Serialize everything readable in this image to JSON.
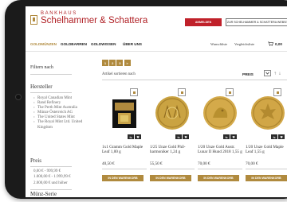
{
  "brand": {
    "top": "BANKHAUS",
    "name": "Schelhammer & Schattera"
  },
  "header": {
    "signup_label": "ANMELDEN",
    "compare_label": "ZUR SCHELHAMMER & SCHATTERA WEBSITE"
  },
  "nav": {
    "items": [
      "GOLDMÜNZEN",
      "GOLDBARREN",
      "GOLDWISSEN",
      "ÜBER UNS"
    ],
    "wishlist": "Wunschliste",
    "compare_list": "Vergleichsliste",
    "cart_total": "0,00"
  },
  "sidebar": {
    "filter_label": "Filtern nach",
    "manufacturer_heading": "Hersteller",
    "manufacturers": [
      "Royal Canadian Mint",
      "Rand Refinery",
      "The Perth Mint Australia",
      "Münze Österreich AG",
      "The United States Mint",
      "The Royal Mint Ltd. United Kingdom"
    ],
    "price_heading": "Preis",
    "prices": [
      "0,00 € - 999,99 €",
      "1.000,00 € - 1.999,99 €",
      "2.000,00 € und höher"
    ],
    "next_heading": "Münz-Serie"
  },
  "main": {
    "pages": [
      "1",
      "2",
      "3",
      ">"
    ],
    "sort_label": "Artikel sortieren nach",
    "sort_value": "PREIS"
  },
  "products": [
    {
      "name": "1x1 Gramm Gold Maple Leaf 1,00 g",
      "price": "40,50 €",
      "button": "IN DEN WARENKORB",
      "coin": "black-box"
    },
    {
      "name": "1/25 Unze Gold Phil-harmoniker 1,24 g",
      "price": "55,50 €",
      "button": "IN DEN WARENKORB",
      "coin": "gold"
    },
    {
      "name": "1/20 Unze Gold Austr. Lunar II Hund 2018 1,55 g",
      "price": "70,00 €",
      "button": "IN DEN WARENKORB",
      "coin": "gold"
    },
    {
      "name": "1/20 Unze Gold Maple Leaf 1,55 g",
      "price": "70,00 €",
      "button": "IN DEN WARENKORB",
      "coin": "gold"
    }
  ],
  "colors": {
    "accent": "#b08a3e",
    "brand_red": "#b02025",
    "tablet": "#1b1b1b"
  }
}
